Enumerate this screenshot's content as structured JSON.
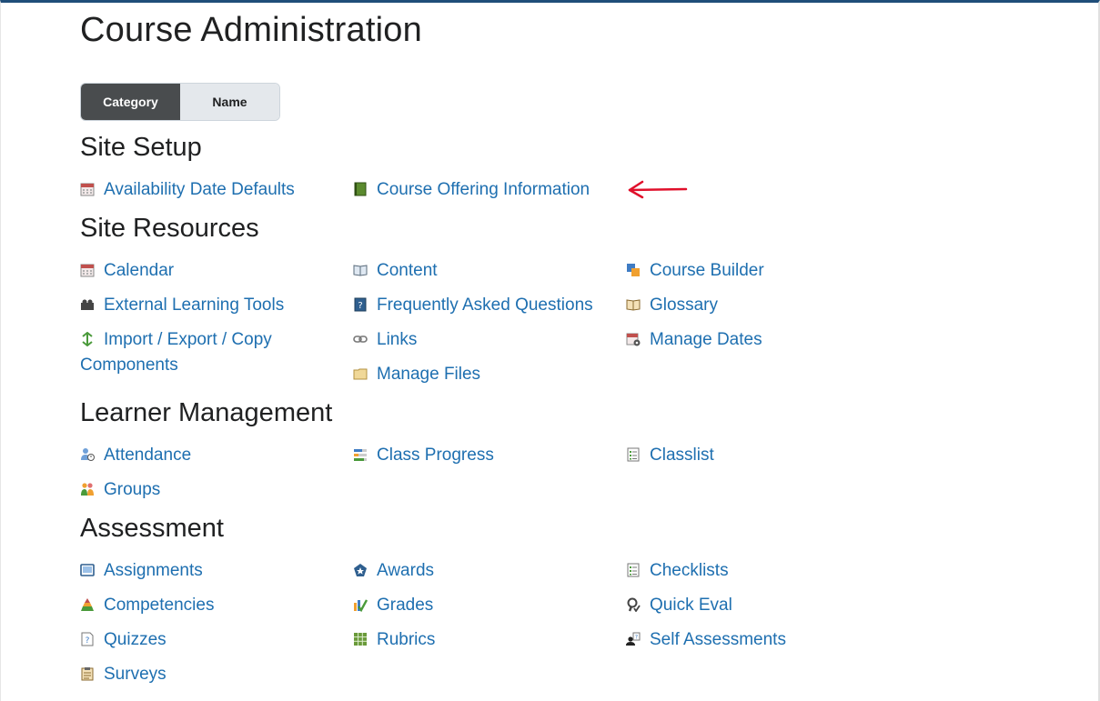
{
  "page": {
    "title": "Course Administration"
  },
  "view_toggle": {
    "category": "Category",
    "name": "Name"
  },
  "sections": {
    "site_setup": {
      "title": "Site Setup",
      "items": [
        "Availability Date Defaults",
        "Course Offering Information"
      ]
    },
    "site_resources": {
      "title": "Site Resources",
      "items": [
        "Calendar",
        "Content",
        "Course Builder",
        "External Learning Tools",
        "Frequently Asked Questions",
        "Glossary",
        "Import / Export / Copy Components",
        "Links",
        "Manage Dates",
        "Manage Files"
      ]
    },
    "learner_management": {
      "title": "Learner Management",
      "items": [
        "Attendance",
        "Class Progress",
        "Classlist",
        "Groups"
      ]
    },
    "assessment": {
      "title": "Assessment",
      "items": [
        "Assignments",
        "Awards",
        "Checklists",
        "Competencies",
        "Grades",
        "Quick Eval",
        "Quizzes",
        "Rubrics",
        "Self Assessments",
        "Surveys"
      ]
    }
  },
  "annotation": {
    "arrow_color": "#e0102b"
  },
  "colors": {
    "link": "#1e6fb0",
    "header_border": "#1f4e79",
    "toggle_active": "#494c4e"
  }
}
